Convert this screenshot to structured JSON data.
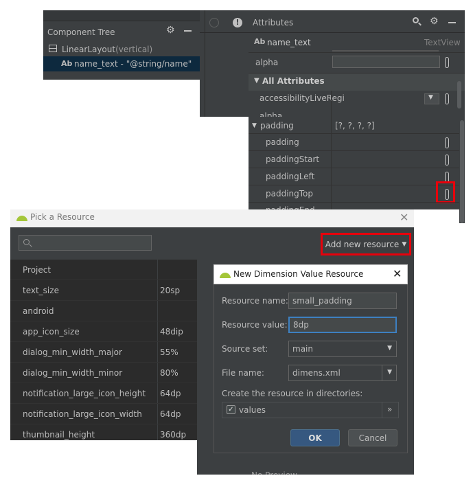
{
  "component_tree": {
    "title": "Component Tree",
    "root_item": "LinearLayout",
    "root_suffix": "(vertical)",
    "child_badge": "Ab",
    "child_item": "name_text",
    "child_suffix": "- \"@string/name\""
  },
  "attributes": {
    "title": "Attributes",
    "component_badge": "Ab",
    "component_name": "name_text",
    "component_type": "TextView",
    "alpha_label": "alpha",
    "all_attributes_label": "All Attributes",
    "accessibility_label": "accessibilityLiveRegi",
    "alpha2_label": "alpha",
    "padding_group_label": "padding",
    "padding_group_value": "[?, ?, ?, ?]",
    "padding_items": [
      "padding",
      "paddingStart",
      "paddingLeft",
      "paddingTop"
    ],
    "partial_label": "paddingEnd"
  },
  "pick_resource": {
    "title": "Pick a Resource",
    "search_placeholder": "",
    "add_new_resource": "Add new resource",
    "rows": [
      {
        "name": "Project",
        "value": ""
      },
      {
        "name": "text_size",
        "value": "20sp"
      },
      {
        "name": "android",
        "value": ""
      },
      {
        "name": "app_icon_size",
        "value": "48dip"
      },
      {
        "name": "dialog_min_width_major",
        "value": "55%"
      },
      {
        "name": "dialog_min_width_minor",
        "value": "80%"
      },
      {
        "name": "notification_large_icon_height",
        "value": "64dp"
      },
      {
        "name": "notification_large_icon_width",
        "value": "64dp"
      },
      {
        "name": "thumbnail_height",
        "value": "360dp"
      }
    ],
    "no_preview": "No Preview"
  },
  "new_dimension": {
    "title": "New Dimension Value Resource",
    "resource_name_label": "Resource name:",
    "resource_name_value": "small_padding",
    "resource_value_label": "Resource value:",
    "resource_value_value": "8dp",
    "source_set_label": "Source set:",
    "source_set_value": "main",
    "file_name_label": "File name:",
    "file_name_value": "dimens.xml",
    "directories_label": "Create the resource in directories:",
    "directory_item": "values",
    "expand_label": "»",
    "ok_label": "OK",
    "cancel_label": "Cancel"
  },
  "colors": {
    "panel_bg": "#3c3f41",
    "dark_bg": "#2b2b2b",
    "dialog_bg": "#3c3f41",
    "highlight_red": "#e8000b",
    "selection_blue": "#0d293e",
    "ok_blue": "#365880",
    "focus_blue": "#3d80c1",
    "android_green": "#a4c639"
  }
}
